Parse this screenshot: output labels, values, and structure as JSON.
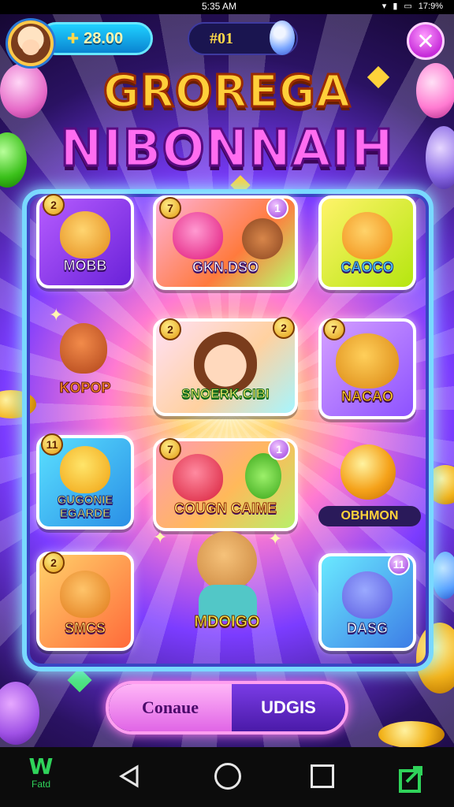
{
  "status_bar": {
    "time": "5:35 AM",
    "battery": "17:9%"
  },
  "hud": {
    "coin_amount": "28.00",
    "level_value": "#01",
    "close_label": "✕"
  },
  "title": {
    "line1": "GROREGA",
    "line2": "NIBONNAIH"
  },
  "tiles": [
    {
      "label": "MOBB",
      "badge": "2"
    },
    {
      "label": "GKN.DSO",
      "badge_left": "7",
      "badge_right": "1"
    },
    {
      "label": "CAOCO"
    },
    {
      "label": "KOPOP"
    },
    {
      "label": "SNOERK.CIBI",
      "badge_left": "2",
      "badge_right": "2"
    },
    {
      "label": "NACAO",
      "badge": "7"
    },
    {
      "label_line1": "GUGONIE",
      "label_line2": "EGARDE",
      "badge": "11"
    },
    {
      "label": "COUGN CAIME",
      "badge_left": "7",
      "badge_right": "1"
    },
    {
      "label": "OBHMON"
    },
    {
      "label": "SMCS",
      "badge": "2"
    },
    {
      "label": "MDOIGO"
    },
    {
      "label": "DASG",
      "badge": "11"
    }
  ],
  "actions": {
    "primary": "Conaue",
    "secondary": "UDGIS"
  },
  "nav": {
    "brand": "Fatd"
  },
  "colors": {
    "accent": "#ff6df0",
    "gold": "#ffcf3a",
    "board_border": "#79d9ff"
  }
}
